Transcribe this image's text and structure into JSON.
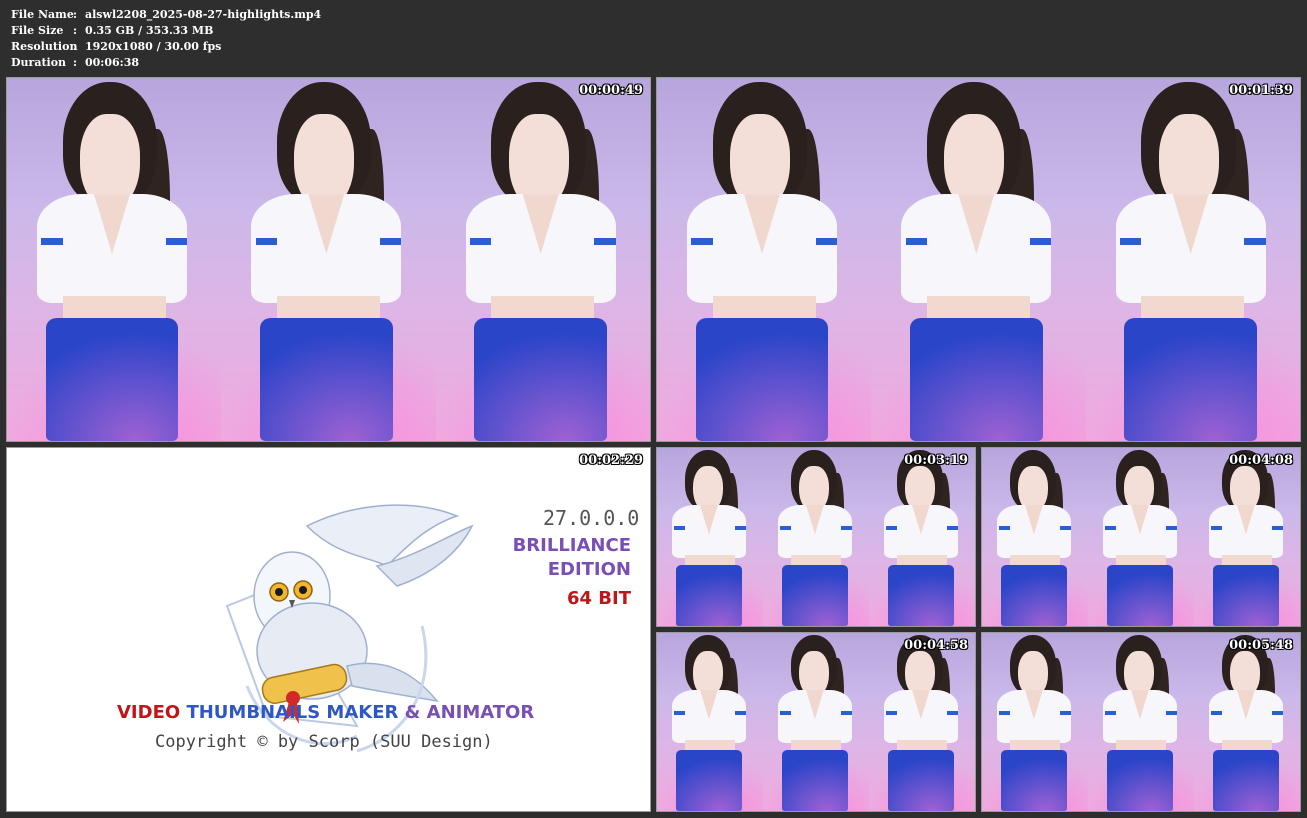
{
  "header": {
    "rows": [
      {
        "key": "File Name",
        "sep": ":",
        "value": "alswl2208_2025-08-27-highlights.mp4"
      },
      {
        "key": "File Size",
        "sep": ":",
        "value": "0.35 GB / 353.33 MB"
      },
      {
        "key": "Resolution",
        "sep": ":",
        "value": "1920x1080 / 30.00 fps"
      },
      {
        "key": "Duration",
        "sep": ":",
        "value": "00:06:38"
      }
    ]
  },
  "thumbnails": [
    {
      "timestamp": "00:00:49"
    },
    {
      "timestamp": "00:01:39"
    },
    {
      "timestamp": "00:02:29"
    },
    {
      "timestamp": "00:03:19"
    },
    {
      "timestamp": "00:04:08"
    },
    {
      "timestamp": "00:04:58"
    },
    {
      "timestamp": "00:05:48"
    }
  ],
  "splash": {
    "version": "27.0.0.0",
    "edition_line1": "BRILLIANCE",
    "edition_line2": "EDITION",
    "bits": "64 BIT",
    "product_video": "VIDEO",
    "product_thumbs": "THUMBNAILS MAKER",
    "product_amp": "& ANIMATOR",
    "copyright": "Copyright © by Scorp (SUU Design)"
  },
  "colors": {
    "background": "#2e2e2e",
    "splash_red": "#c0161a",
    "splash_blue": "#2f57c4",
    "splash_purple": "#7a4fb5",
    "skirt_blue": "#2b45c9"
  }
}
